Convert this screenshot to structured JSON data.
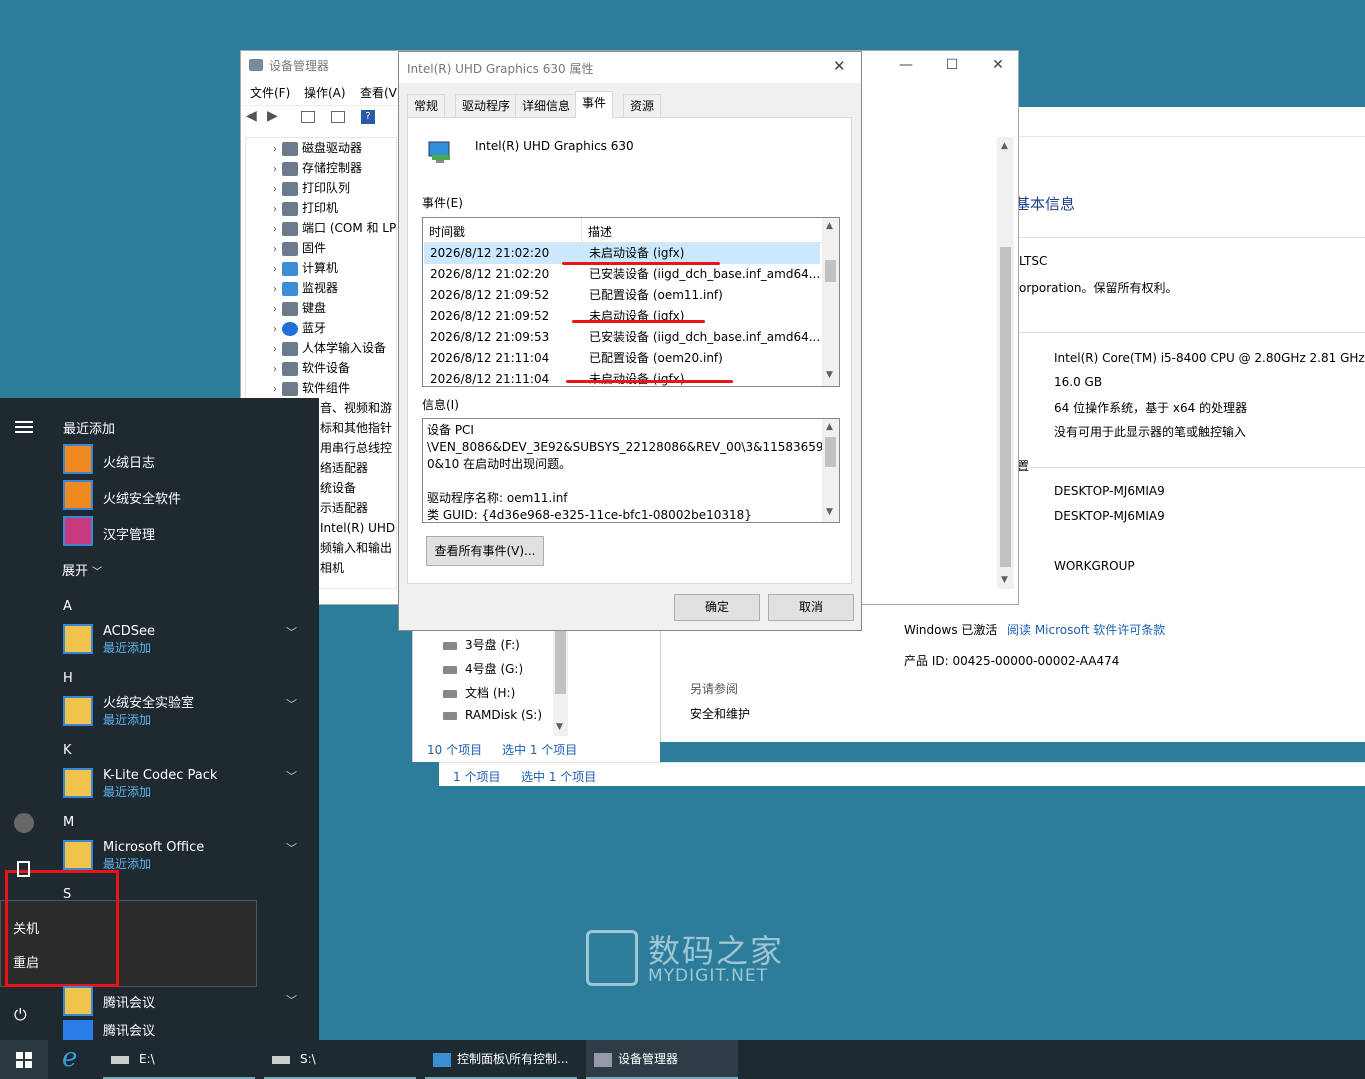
{
  "system_window": {
    "section_title": "基本信息",
    "edition_partial": "LTSC",
    "copyright_partial": "orporation。保留所有权利。",
    "processor": "Intel(R) Core(TM) i5-8400 CPU @ 2.80GHz   2.81 GHz",
    "ram": "16.0 GB",
    "system_type": "64 位操作系统，基于 x64 的处理器",
    "pen_touch": "没有可用于此显示器的笔或触控输入",
    "name_header_partial": "置",
    "computer_name": "DESKTOP-MJ6MIA9",
    "full_name": "DESKTOP-MJ6MIA9",
    "workgroup": "WORKGROUP",
    "activation_status": "Windows 已激活",
    "license_link": "阅读 Microsoft 软件许可条款",
    "product_id": "产品 ID: 00425-00000-00002-AA474",
    "see_also": "另请参阅",
    "security_link": "安全和维护",
    "status_bar_items": "1 个项目",
    "status_bar_selected": "选中 1 个项目"
  },
  "explorer_window": {
    "drives": [
      "3号盘 (F:)",
      "4号盘 (G:)",
      "文档 (H:)",
      "RAMDisk (S:)"
    ],
    "status_items": "10 个项目",
    "status_selected": "选中 1 个项目"
  },
  "device_manager": {
    "title": "设备管理器",
    "menu": [
      "文件(F)",
      "操作(A)",
      "查看(V)"
    ],
    "tree": [
      "磁盘驱动器",
      "存储控制器",
      "打印队列",
      "打印机",
      "端口 (COM 和 LPT)",
      "固件",
      "计算机",
      "监视器",
      "键盘",
      "蓝牙",
      "人体学输入设备",
      "软件设备",
      "软件组件"
    ],
    "tree_partial": [
      "音、视频和游",
      "标和其他指针",
      "用串行总线控",
      "络适配器",
      "统设备",
      "示适配器",
      "Intel(R) UHD",
      "频输入和输出",
      "相机"
    ]
  },
  "dialog": {
    "title": "Intel(R) UHD Graphics 630 属性",
    "tabs": [
      "常规",
      "驱动程序",
      "详细信息",
      "事件",
      "资源"
    ],
    "device_name": "Intel(R) UHD Graphics 630",
    "events_label": "事件(E)",
    "col_timestamp": "时间戳",
    "col_description": "描述",
    "events": [
      {
        "time": "2026/8/12 21:02:20",
        "desc": "未启动设备 (igfx)"
      },
      {
        "time": "2026/8/12 21:02:20",
        "desc": "已安装设备 (iigd_dch_base.inf_amd64..."
      },
      {
        "time": "2026/8/12 21:09:52",
        "desc": "已配置设备 (oem11.inf)"
      },
      {
        "time": "2026/8/12 21:09:52",
        "desc": "未启动设备 (igfx)"
      },
      {
        "time": "2026/8/12 21:09:53",
        "desc": "已安装设备 (iigd_dch_base.inf_amd64..."
      },
      {
        "time": "2026/8/12 21:11:04",
        "desc": "已配置设备 (oem20.inf)"
      },
      {
        "time": "2026/8/12 21:11:04",
        "desc": "未启动设备 (igfx)"
      }
    ],
    "info_label": "信息(I)",
    "info_line1": "设备 PCI",
    "info_line2": "\\VEN_8086&DEV_3E92&SUBSYS_22128086&REV_00\\3&11583659&",
    "info_line3": "0&10 在启动时出现问题。",
    "info_line4": "驱动程序名称: oem11.inf",
    "info_line5": "类 GUID: {4d36e968-e325-11ce-bfc1-08002be10318}",
    "view_all_button": "查看所有事件(V)...",
    "ok_button": "确定",
    "cancel_button": "取消"
  },
  "start_menu": {
    "recent_header": "最近添加",
    "recent_apps": [
      "火绒日志",
      "火绒安全软件",
      "汉字管理"
    ],
    "expand": "展开",
    "groups": [
      {
        "letter": "A",
        "app": "ACDSee",
        "sub": "最近添加"
      },
      {
        "letter": "H",
        "app": "火绒安全实验室",
        "sub": "最近添加"
      },
      {
        "letter": "K",
        "app": "K-Lite Codec Pack",
        "sub": "最近添加"
      },
      {
        "letter": "M",
        "app": "Microsoft Office",
        "sub": "最近添加"
      }
    ],
    "letter_s": "S",
    "power_menu": [
      "关机",
      "重启"
    ],
    "bottom_apps": [
      "腾讯会议",
      "腾讯会议"
    ]
  },
  "watermark": {
    "cn": "数码之家",
    "en": "MYDIGIT.NET"
  },
  "taskbar": {
    "items": [
      "E:\\",
      "S:\\",
      "控制面板\\所有控制...",
      "设备管理器"
    ]
  },
  "colors": {
    "desktop": "#2c7d9c",
    "start_bg": "#1f2a30",
    "taskbar": "#1d2a31",
    "link": "#1a5fb4",
    "highlight": "#e8141c"
  }
}
